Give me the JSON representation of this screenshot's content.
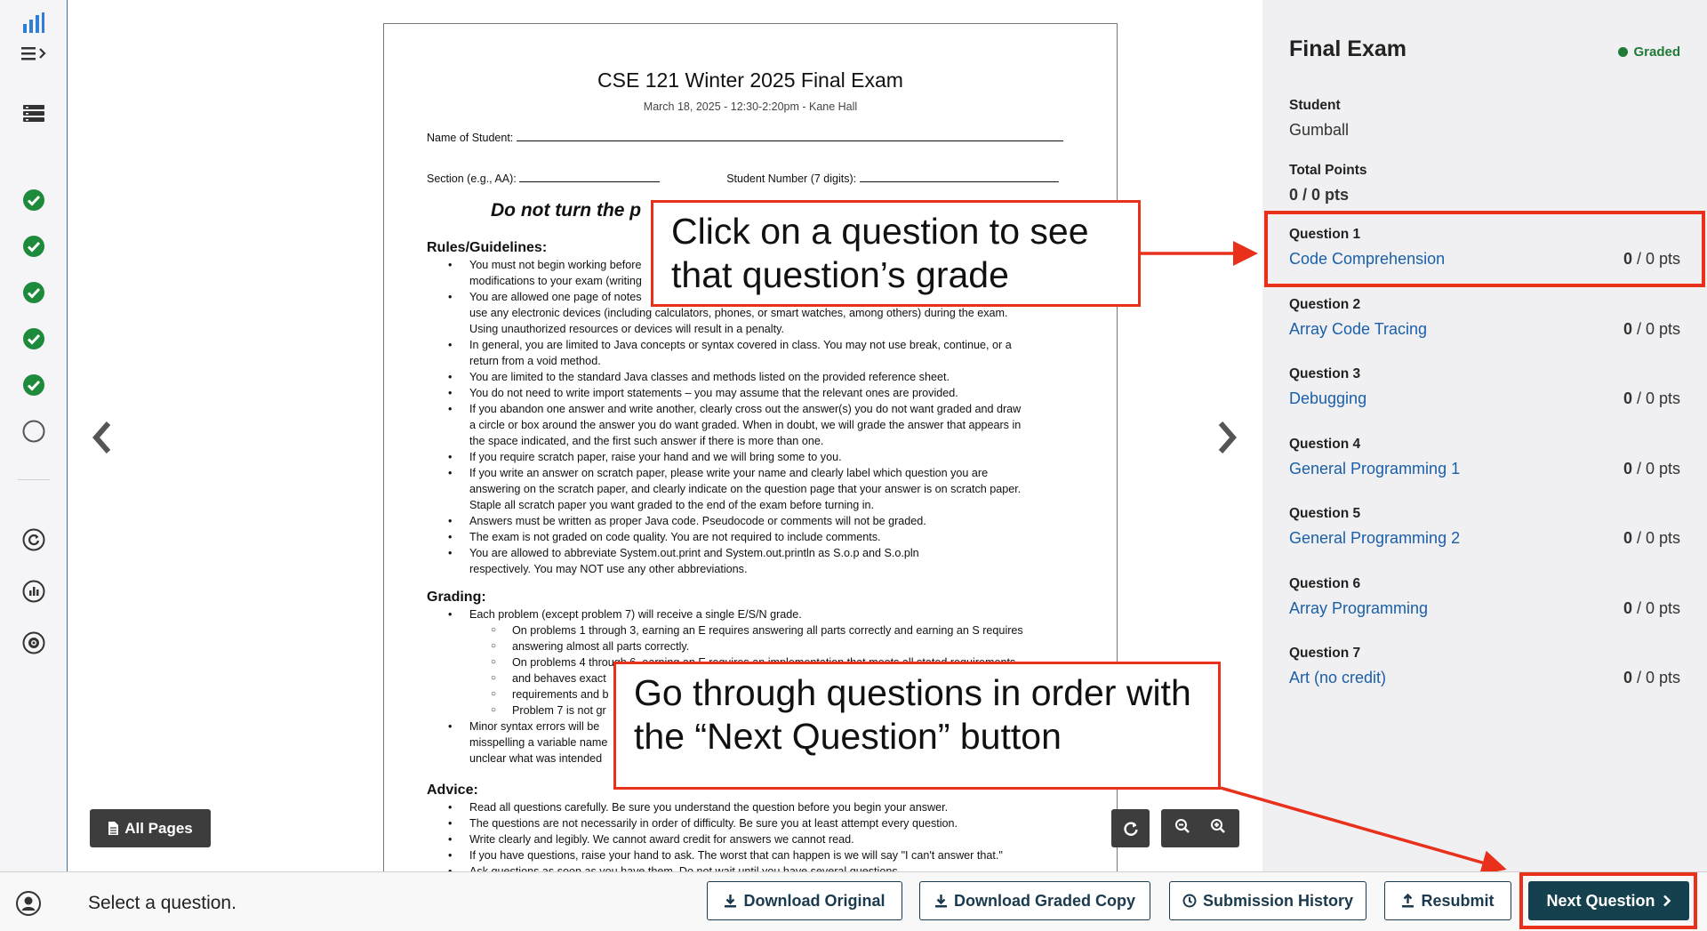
{
  "rail": {
    "icons": [
      "bar-chart-icon",
      "menu-expand-icon",
      "outline-icon",
      "check-circle-icon",
      "check-circle-icon",
      "check-circle-icon",
      "check-circle-icon",
      "check-circle-icon",
      "empty-circle-icon",
      "regrade-icon",
      "statistics-icon",
      "settings-icon",
      "user-icon"
    ],
    "check_color": "#1e8a3c"
  },
  "exam_page": {
    "title": "CSE 121 Winter 2025 Final Exam",
    "subtitle": "March 18, 2025 - 12:30-2:20pm - Kane Hall",
    "name_label": "Name of Student:",
    "section_label": "Section (e.g., AA):",
    "student_number_label": "Student Number (7 digits):",
    "warning": "Do not turn the p",
    "rules_heading": "Rules/Guidelines:",
    "rules": [
      "You must not begin working before",
      "modifications to your exam (writing",
      "You are allowed one page of notes",
      "use any electronic devices (including calculators, phones, or smart watches, among others) during the exam.",
      "Using unauthorized resources or devices will result in a penalty.",
      "In general, you are limited to Java concepts or syntax covered in class. You may not use break, continue, or a",
      "return from a void method.",
      "You are limited to the standard Java classes and methods listed on the provided reference sheet.",
      "You do not need to write import statements – you may assume that the relevant ones are provided.",
      "If you abandon one answer and write another, clearly cross out the answer(s) you do not want graded and draw",
      "a circle or box around the answer you do want graded. When in doubt, we will grade the answer that appears in",
      "the space indicated, and the first such answer if there is more than one.",
      "If you require scratch paper, raise your hand and we will bring some to you.",
      "If you write an answer on scratch paper, please write your name and clearly label which question you are",
      "answering on the scratch paper, and clearly indicate on the question page that your answer is on scratch paper.",
      "Staple all scratch paper you want graded to the end of the exam before turning in.",
      "Answers must be written as proper Java code. Pseudocode or comments will not be graded.",
      "The exam is not graded on code quality. You are not required to include comments.",
      "You are allowed to abbreviate System.out.print and System.out.println as S.o.p and S.o.pln",
      "respectively. You may NOT use any other abbreviations."
    ],
    "grading_heading": "Grading:",
    "grading": [
      "Each problem (except problem 7) will receive a single E/S/N grade.",
      "On problems 1 through 3, earning an E requires answering all parts correctly and earning an S requires",
      "answering almost all parts correctly.",
      "On problems 4 through 6, earning an E requires an implementation that meets all stated requirements",
      "and behaves exact",
      "requirements and b",
      "Problem 7 is not gr",
      "Minor syntax errors will be",
      "misspelling a variable name",
      "unclear what was intended"
    ],
    "advice_heading": "Advice:",
    "advice": [
      "Read all questions carefully. Be sure you understand the question before you begin your answer.",
      "The questions are not necessarily in order of difficulty. Be sure you at least attempt every question.",
      "Write clearly and legibly. We cannot award credit for answers we cannot read.",
      "If you have questions, raise your hand to ask. The worst that can happen is we will say \"I can't answer that.\"",
      "Ask questions as soon as you have them. Do not wait until you have several questions."
    ]
  },
  "viewer": {
    "all_pages_label": "All Pages",
    "icons": [
      "chevron-left-icon",
      "chevron-right-icon",
      "rotate-icon",
      "zoom-out-icon",
      "zoom-in-icon",
      "file-icon"
    ]
  },
  "callouts": {
    "question_grade": "Click on a question to see that question’s grade",
    "next_question": "Go through questions in order with the “Next Question” button",
    "accent_color": "#e8301a"
  },
  "panel": {
    "title": "Final Exam",
    "status": "Graded",
    "status_color": "#1e7a36",
    "student_label": "Student",
    "student_name": "Gumball",
    "total_label": "Total Points",
    "total_value": "0 / 0 pts",
    "questions": [
      {
        "number": "Question 1",
        "name": "Code Comprehension",
        "score": "0",
        "max": " / 0 pts"
      },
      {
        "number": "Question 2",
        "name": "Array Code Tracing",
        "score": "0",
        "max": " / 0 pts"
      },
      {
        "number": "Question 3",
        "name": "Debugging",
        "score": "0",
        "max": " / 0 pts"
      },
      {
        "number": "Question 4",
        "name": "General Programming 1",
        "score": "0",
        "max": " / 0 pts"
      },
      {
        "number": "Question 5",
        "name": "General Programming 2",
        "score": "0",
        "max": " / 0 pts"
      },
      {
        "number": "Question 6",
        "name": "Array Programming",
        "score": "0",
        "max": " / 0 pts"
      },
      {
        "number": "Question 7",
        "name": "Art (no credit)",
        "score": "0",
        "max": " / 0 pts"
      }
    ],
    "link_color": "#1a5fa8"
  },
  "bottom_bar": {
    "status": "Select a question.",
    "download_original": "Download Original",
    "download_graded": "Download Graded Copy",
    "submission_history": "Submission History",
    "resubmit": "Resubmit",
    "next_question": "Next Question"
  }
}
